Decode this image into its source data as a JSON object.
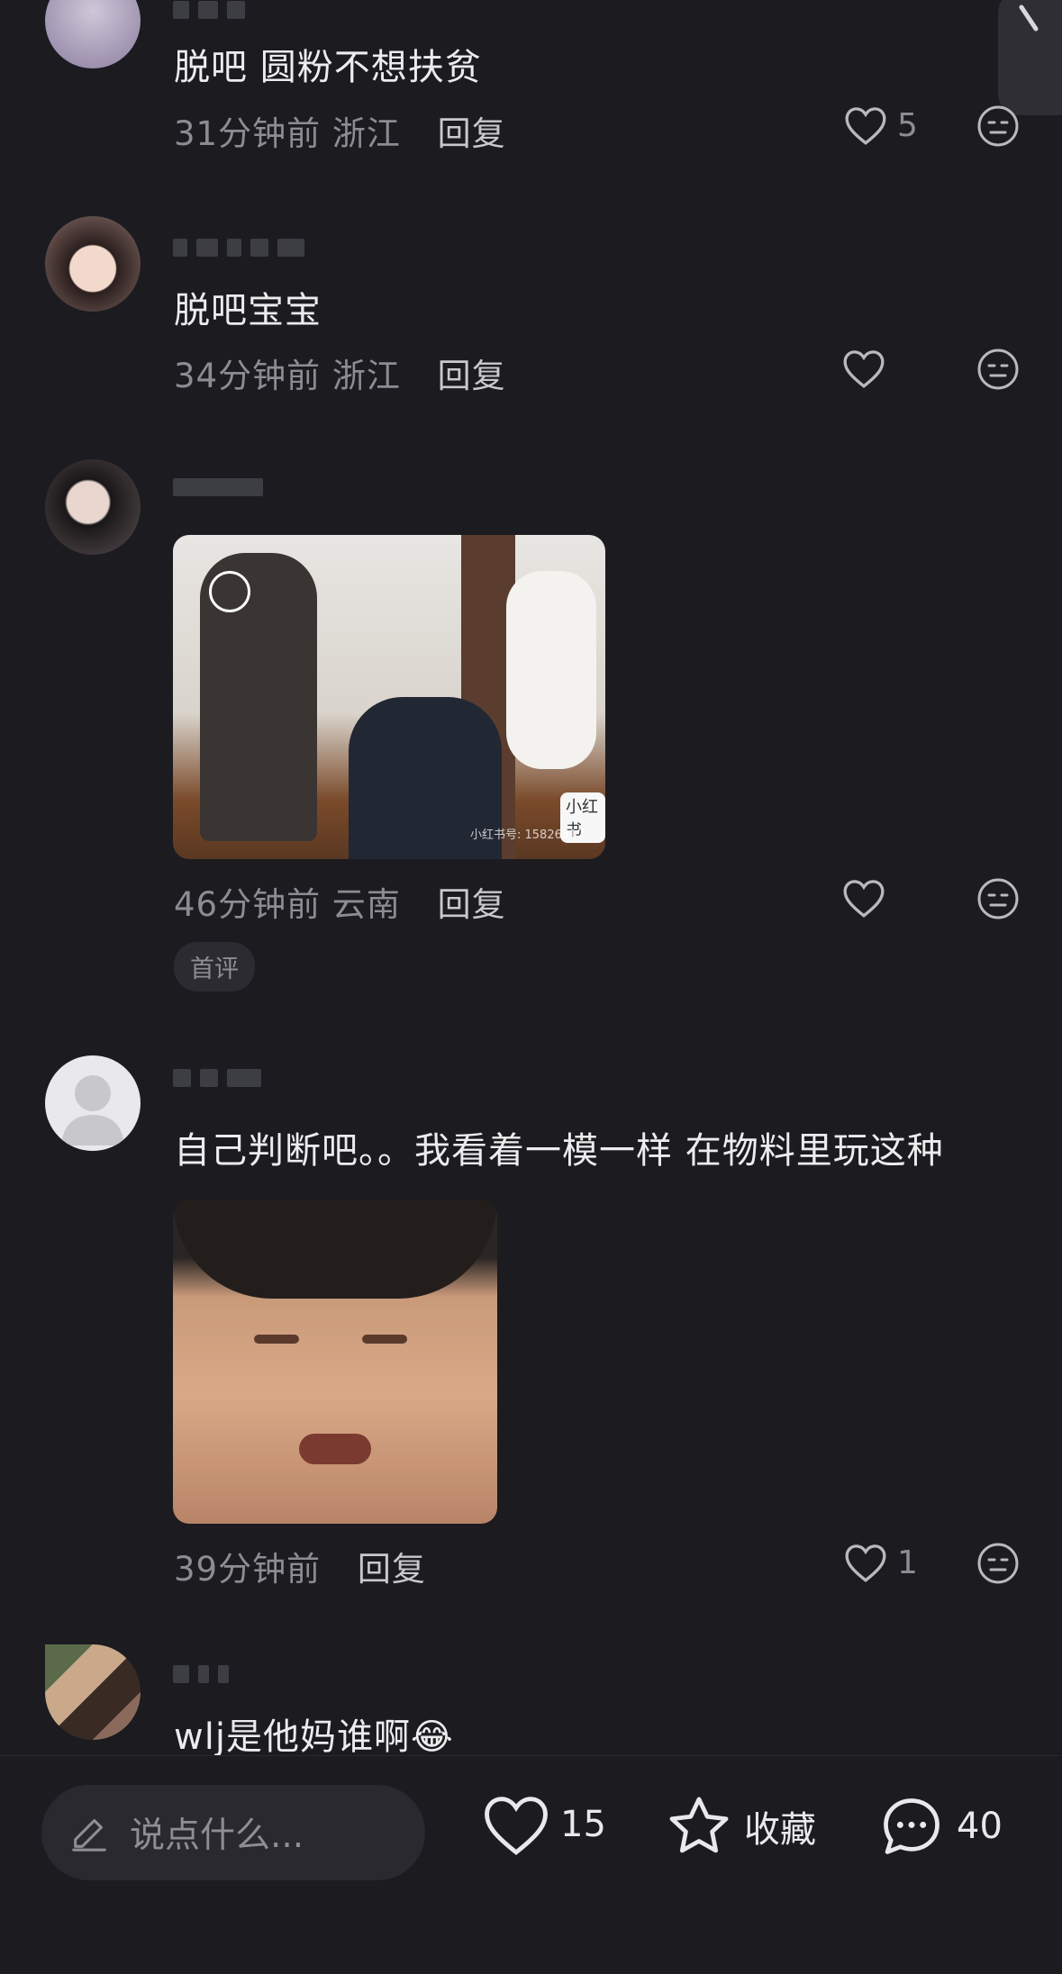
{
  "comments": [
    {
      "text": "脱吧 圆粉不想扶贫",
      "time": "31分钟前",
      "region": "浙江",
      "reply_label": "回复",
      "like_count": "5"
    },
    {
      "text": "脱吧宝宝",
      "time": "34分钟前",
      "region": "浙江",
      "reply_label": "回复",
      "like_count": ""
    },
    {
      "text": "",
      "time": "46分钟前",
      "region": "云南",
      "reply_label": "回复",
      "like_count": "",
      "badge": "首评",
      "image_overlay_text": "小红书",
      "image_watermark": "小红书号: 15826517"
    },
    {
      "text": "自己判断吧。。我看着一模一样 在物料里玩这种",
      "time": "39分钟前",
      "region": "",
      "reply_label": "回复",
      "like_count": "1"
    },
    {
      "text": "wlj是他妈谁啊😂"
    }
  ],
  "bottom_bar": {
    "input_placeholder": "说点什么...",
    "like_count": "15",
    "collect_label": "收藏",
    "comment_count": "40"
  },
  "icons": {
    "like": "heart-outline-icon",
    "dislike": "neutral-face-icon",
    "edit": "pencil-icon",
    "collect": "star-outline-icon",
    "comment": "chat-bubble-icon"
  }
}
